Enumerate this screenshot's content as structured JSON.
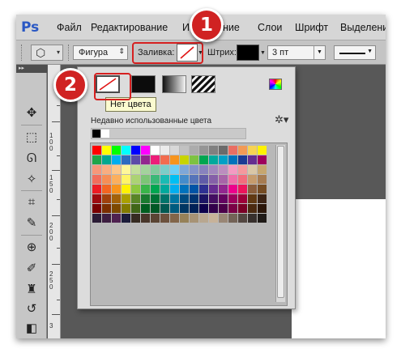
{
  "app": {
    "logo": "Ps",
    "menu": [
      "Файл",
      "Редактирование",
      "И",
      "ние",
      "Слои",
      "Шрифт",
      "Выделени"
    ]
  },
  "options_bar": {
    "preset_icon": "hexagon-icon",
    "mode_value": "Фигура",
    "fill_label": "Заливка:",
    "fill_value": "no-color",
    "stroke_label": "Штрих:",
    "stroke_color": "#000000",
    "stroke_width_value": "3 пт",
    "stroke_type": "solid-line"
  },
  "tools": [
    "move-icon",
    "marquee-icon",
    "lasso-icon",
    "magic-wand-icon",
    "crop-icon",
    "eyedropper-icon",
    "healing-icon",
    "brush-icon",
    "stamp-icon",
    "history-brush-icon",
    "eraser-icon"
  ],
  "ruler": {
    "numbers": [
      "1",
      "0",
      "0",
      "1",
      "5",
      "0",
      "2",
      "0",
      "0",
      "2",
      "5",
      "0",
      "3"
    ]
  },
  "fill_panel": {
    "types": [
      "no-color",
      "solid-color",
      "gradient",
      "pattern"
    ],
    "picker_icon": "color-picker-icon",
    "tooltip": "Нет цвета",
    "recent_label": "Недавно использованные цвета",
    "recent_colors": [
      "#000000",
      "#ffffff"
    ],
    "settings_icon": "gear-icon",
    "swatches": [
      [
        "#ff0000",
        "#ffff00",
        "#00ff00",
        "#00ffff",
        "#0000ff",
        "#ff00ff",
        "#ffffff",
        "#ececec",
        "#d8d8d8",
        "#c2c2c2",
        "#acacac",
        "#959595",
        "#808080",
        "#6b6b6b",
        "#ea6e63",
        "#f29a55",
        "#f7d352",
        "#fff200"
      ],
      [
        "#1fa54a",
        "#00a88f",
        "#00aeef",
        "#2e6cc0",
        "#5c4aa8",
        "#92278f",
        "#ed1e79",
        "#f26c4f",
        "#f7941d",
        "#c8d400",
        "#7dc242",
        "#00a651",
        "#00a99d",
        "#00a0c6",
        "#0072bc",
        "#1b3a94",
        "#652d90",
        "#9e005d"
      ],
      [
        "#f7977a",
        "#f9ad81",
        "#fdc68a",
        "#fff79a",
        "#c4df9b",
        "#a3d39c",
        "#82ca9d",
        "#7bcdc8",
        "#6ecff6",
        "#7ea7d8",
        "#8493ca",
        "#8882be",
        "#a187be",
        "#bc8dbf",
        "#f49ac2",
        "#f5989d",
        "#d9c7a6",
        "#c6a66f"
      ],
      [
        "#f26d5c",
        "#f68e56",
        "#fbaf5d",
        "#fff467",
        "#acd373",
        "#7cc576",
        "#3bb878",
        "#1abbb4",
        "#00bff3",
        "#448ccb",
        "#5674b9",
        "#605ca8",
        "#8560a8",
        "#a864a8",
        "#f06ea9",
        "#f26d7d",
        "#c69c6d",
        "#a67c52"
      ],
      [
        "#ed1c24",
        "#f26522",
        "#f7941d",
        "#fff200",
        "#8dc73f",
        "#39b54a",
        "#00a651",
        "#00a99d",
        "#00aeef",
        "#0072bc",
        "#0054a6",
        "#2e3192",
        "#662d91",
        "#92278f",
        "#ec008c",
        "#ed145b",
        "#8b5e3c",
        "#754c24"
      ],
      [
        "#9e0b0f",
        "#a0410d",
        "#a36209",
        "#aba000",
        "#598527",
        "#1a7b30",
        "#007236",
        "#00746b",
        "#0076a3",
        "#004b80",
        "#003471",
        "#1b1464",
        "#440e62",
        "#630460",
        "#9e005d",
        "#9e0039",
        "#603913",
        "#3c2415"
      ],
      [
        "#790000",
        "#7b2e00",
        "#7d4900",
        "#827b00",
        "#406618",
        "#005e20",
        "#005826",
        "#005952",
        "#005b7f",
        "#003663",
        "#002157",
        "#0d004c",
        "#32004b",
        "#4b0049",
        "#7b0046",
        "#7a0026",
        "#4b2a10",
        "#2b1609"
      ],
      [
        "#2b1c35",
        "#3d1e40",
        "#4f2150",
        "#1c1c3a",
        "#362b22",
        "#48362a",
        "#5a4433",
        "#6c513d",
        "#826549",
        "#968158",
        "#a79375",
        "#b8a790",
        "#c7b299",
        "#998675",
        "#736357",
        "#534741",
        "#37302d",
        "#1f1a17"
      ]
    ]
  },
  "callouts": [
    "1",
    "2"
  ]
}
